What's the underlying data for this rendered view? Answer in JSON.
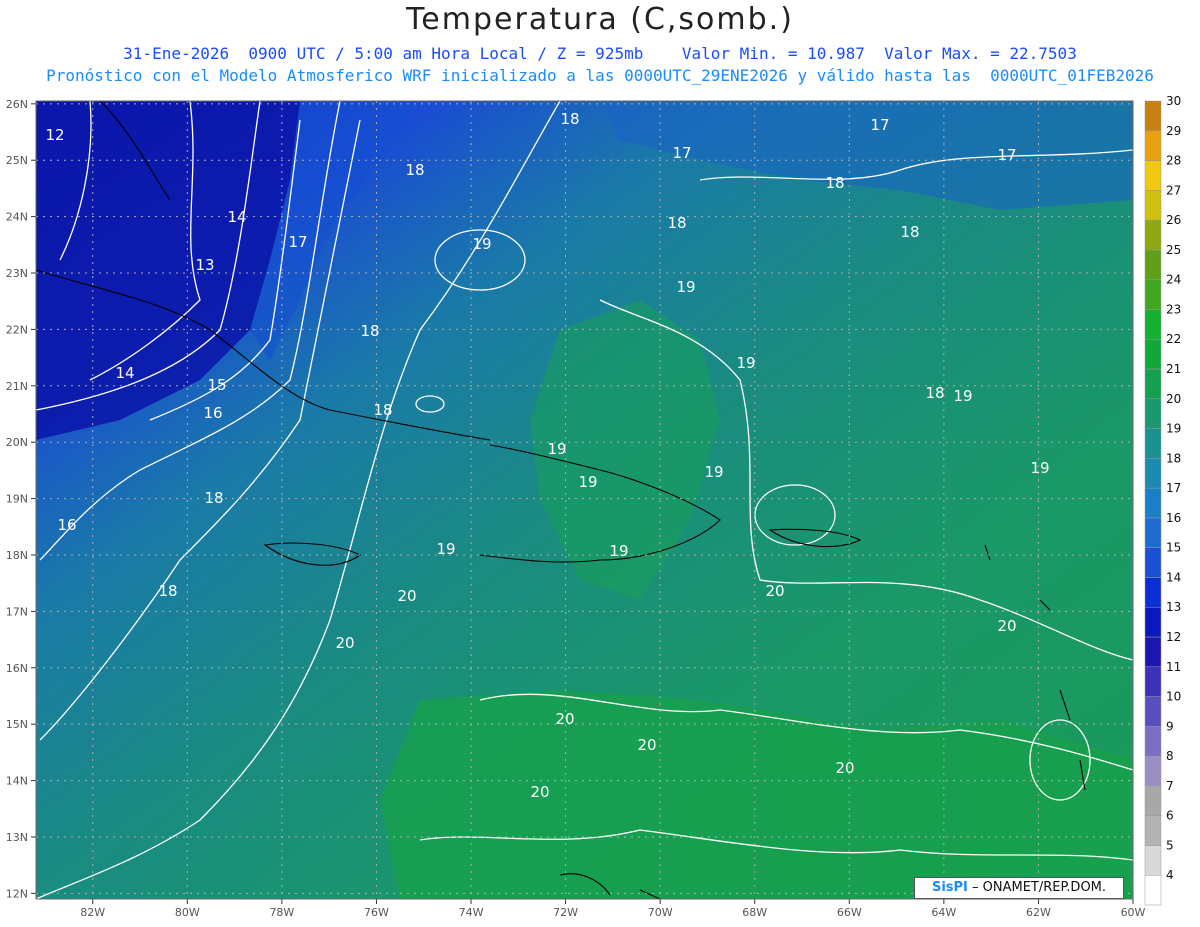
{
  "header": {
    "title": "Temperatura (C,somb.)",
    "line1": "31-Ene-2026  0900 UTC / 5:00 am Hora Local / Z = 925mb    Valor Min. = 10.987  Valor Max. = 22.7503",
    "line2": "Pronóstico con el Modelo Atmosferico WRF inicializado a las 0000UTC_29ENE2026 y válido hasta las  0000UTC_01FEB2026"
  },
  "map": {
    "lon_labels": [
      "82W",
      "80W",
      "78W",
      "76W",
      "74W",
      "72W",
      "70W",
      "68W",
      "66W",
      "64W",
      "62W",
      "60W"
    ],
    "lat_labels": [
      "12N",
      "13N",
      "14N",
      "15N",
      "16N",
      "17N",
      "18N",
      "19N",
      "20N",
      "21N",
      "22N",
      "23N",
      "24N",
      "25N",
      "26N"
    ],
    "contour_labels": [
      "12",
      "13",
      "14",
      "14",
      "15",
      "16",
      "16",
      "17",
      "17",
      "17",
      "17",
      "18",
      "18",
      "18",
      "18",
      "18",
      "18",
      "18",
      "18",
      "18",
      "18",
      "19",
      "19",
      "19",
      "19",
      "19",
      "19",
      "19",
      "19",
      "19",
      "19",
      "20",
      "20",
      "20",
      "20",
      "20",
      "20",
      "20",
      "20"
    ]
  },
  "colorbar": {
    "labels": [
      "4",
      "5",
      "6",
      "7",
      "8",
      "9",
      "10",
      "11",
      "12",
      "13",
      "14",
      "15",
      "16",
      "17",
      "18",
      "19",
      "20",
      "21",
      "22",
      "23",
      "24",
      "25",
      "26",
      "27",
      "28",
      "29",
      "30"
    ],
    "colors": [
      "#ffffff",
      "#d9d9d9",
      "#b3b3b3",
      "#a8a8a8",
      "#9b8fc4",
      "#7b6fc4",
      "#5a4fc0",
      "#3a32b8",
      "#1a16b0",
      "#0a18c0",
      "#0a2ed8",
      "#1a4fd8",
      "#1f6cd0",
      "#1a7ec8",
      "#1a8ab0",
      "#1a9090",
      "#1a9870",
      "#14a050",
      "#10a838",
      "#14b030",
      "#40a820",
      "#60a018",
      "#90a810",
      "#d0c010",
      "#f0c810",
      "#e8a010",
      "#c88010"
    ]
  },
  "credit": {
    "logo": "SisPI",
    "text": " – ONAMET/REP.DOM."
  }
}
